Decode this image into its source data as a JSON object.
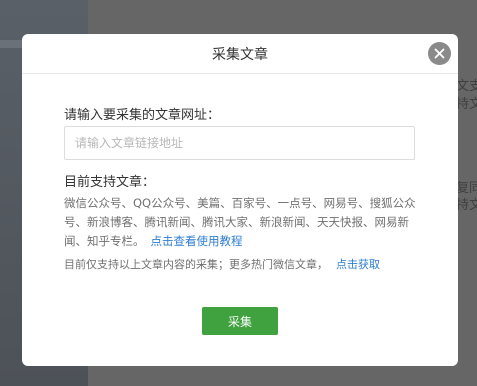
{
  "background": {
    "snippets": [
      "文支",
      "持文",
      "复同",
      "持文"
    ]
  },
  "dialog": {
    "title": "采集文章",
    "close_icon": "close-icon",
    "url_label": "请输入要采集的文章网址：",
    "url_placeholder": "请输入文章链接地址",
    "url_value": "",
    "support_label": "目前支持文章：",
    "support_list": "微信公众号、QQ公众号、美篇、百家号、一点号、网易号、搜狐公众号、新浪博客、腾讯新闻、腾讯大家、新浪新闻、天天快报、网易新闻、知乎专栏。",
    "tutorial_link": "点击查看使用教程",
    "note": "目前仅支持以上文章内容的采集；更多热门微信文章，",
    "get_link": "点击获取",
    "submit_label": "采集"
  },
  "colors": {
    "accent_green": "#3fa23e",
    "link_blue": "#2e7ed0",
    "overlay": "#666666"
  }
}
